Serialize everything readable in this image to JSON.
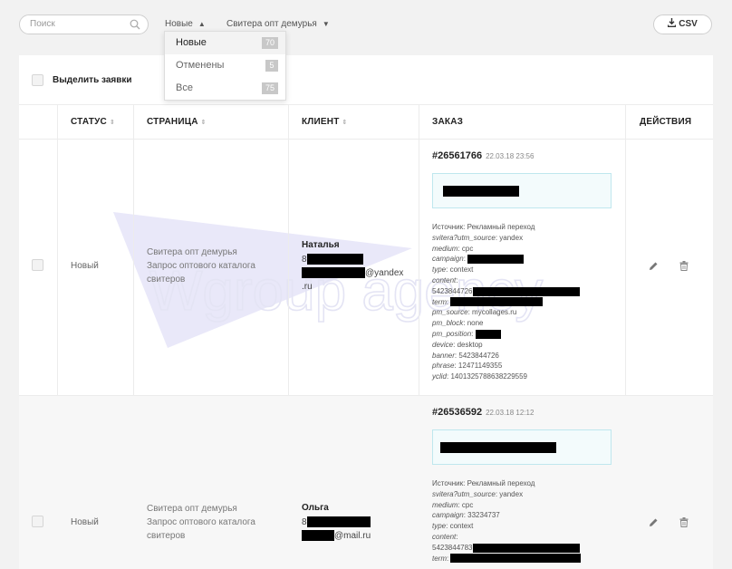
{
  "toolbar": {
    "search_placeholder": "Поиск",
    "filter_status": "Новые",
    "filter_status_arrow": "▲",
    "filter_page": "Свитера опт демурья",
    "filter_page_arrow": "▼",
    "csv_label": "CSV"
  },
  "dropdown": {
    "items": [
      {
        "label": "Новые",
        "count": "70"
      },
      {
        "label": "Отменены",
        "count": "5"
      },
      {
        "label": "Все",
        "count": "75"
      }
    ]
  },
  "table": {
    "select_all_label": "Выделить заявки",
    "columns": {
      "status": "СТАТУС",
      "page": "СТРАНИЦА",
      "client": "КЛИЕНТ",
      "order": "ЗАКАЗ",
      "actions": "ДЕЙСТВИЯ"
    },
    "sort_glyph": "⇕",
    "rows": [
      {
        "status": "Новый",
        "page_line1": "Свитера опт демурья",
        "page_line2": "Запрос оптового каталога",
        "page_line3": "свитеров",
        "client_name": "Наталья",
        "client_phone_prefix": "8",
        "client_email_suffix": "@yandex",
        "client_email_tail": ".ru",
        "order_no": "#26561766",
        "order_date": "22.03.18 23:56",
        "meta": {
          "source": "Источник: Рекламный переход",
          "svitera_key": "svitera?utm_source",
          "svitera_val": "yandex",
          "medium_key": "medium",
          "medium_val": "cpc",
          "campaign_key": "campaign",
          "type_key": "type",
          "type_val": "context",
          "content_key": "content",
          "content_val": "5423844726",
          "term_key": "term",
          "pm_source_key": "pm_source",
          "pm_source_val": "mycollages.ru",
          "pm_block_key": "pm_block",
          "pm_block_val": "none",
          "pm_position_key": "pm_position",
          "device_key": "device",
          "device_val": "desktop",
          "banner_key": "banner",
          "banner_val": "5423844726",
          "phrase_key": "phrase",
          "phrase_val": "12471149355",
          "yclid_key": "yclid",
          "yclid_val": "1401325788638229559"
        }
      },
      {
        "status": "Новый",
        "page_line1": "Свитера опт демурья",
        "page_line2": "Запрос оптового каталога",
        "page_line3": "свитеров",
        "client_name": "Ольга",
        "client_phone_prefix": "8",
        "client_email_suffix": "@mail.ru",
        "order_no": "#26536592",
        "order_date": "22.03.18 12:12",
        "meta": {
          "source": "Источник: Рекламный переход",
          "svitera_key": "svitera?utm_source",
          "svitera_val": "yandex",
          "medium_key": "medium",
          "medium_val": "cpc",
          "campaign_key": "campaign",
          "campaign_val": "33234737",
          "type_key": "type",
          "type_val": "context",
          "content_key": "content",
          "content_val": "5423844783",
          "term_key": "term"
        }
      }
    ]
  },
  "watermark_text": "Wgroup agency",
  "colors": {
    "background": "#f2f2f2",
    "panel": "#ffffff",
    "order_box_border": "#bfe7ee",
    "badge": "#c8c8c8"
  }
}
